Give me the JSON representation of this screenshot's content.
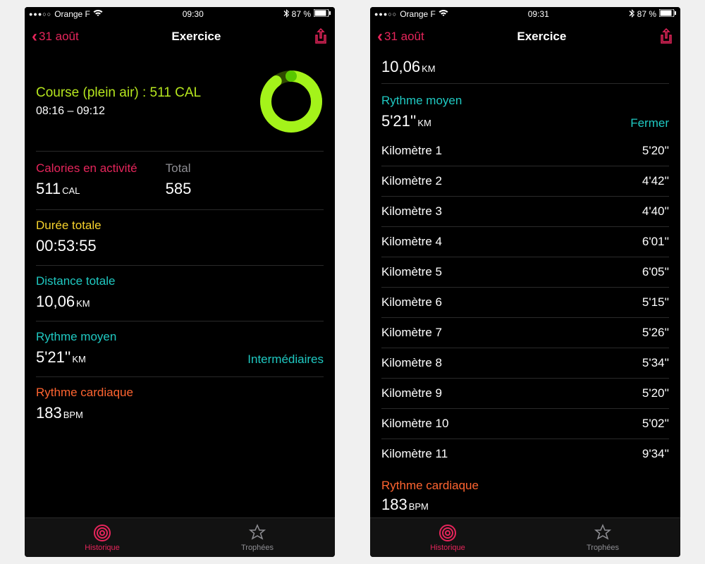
{
  "left": {
    "status": {
      "carrier": "Orange F",
      "time": "09:30",
      "battery": "87 %"
    },
    "nav": {
      "back": "31 août",
      "title": "Exercice"
    },
    "hero": {
      "title": "Course (plein air) : 511 CAL",
      "time": "08:16 – 09:12"
    },
    "active": {
      "label": "Calories en activité",
      "value": "511",
      "unit": "CAL"
    },
    "total": {
      "label": "Total",
      "value": "585"
    },
    "duration": {
      "label": "Durée totale",
      "value": "00:53:55"
    },
    "distance": {
      "label": "Distance totale",
      "value": "10,06",
      "unit": "KM"
    },
    "pace": {
      "label": "Rythme moyen",
      "value": "5'21''",
      "unit": "KM",
      "splits_btn": "Intermédiaires"
    },
    "hr": {
      "label": "Rythme cardiaque",
      "value": "183",
      "unit": "BPM"
    },
    "tabs": {
      "history": "Historique",
      "trophies": "Trophées"
    }
  },
  "right": {
    "status": {
      "carrier": "Orange F",
      "time": "09:31",
      "battery": "87 %"
    },
    "nav": {
      "back": "31 août",
      "title": "Exercice"
    },
    "distance": {
      "value": "10,06",
      "unit": "KM"
    },
    "pace": {
      "label": "Rythme moyen",
      "value": "5'21''",
      "unit": "KM",
      "close_btn": "Fermer"
    },
    "splits": [
      {
        "label": "Kilomètre 1",
        "value": "5'20''"
      },
      {
        "label": "Kilomètre 2",
        "value": "4'42''"
      },
      {
        "label": "Kilomètre 3",
        "value": "4'40''"
      },
      {
        "label": "Kilomètre 4",
        "value": "6'01''"
      },
      {
        "label": "Kilomètre 5",
        "value": "6'05''"
      },
      {
        "label": "Kilomètre 6",
        "value": "5'15''"
      },
      {
        "label": "Kilomètre 7",
        "value": "5'26''"
      },
      {
        "label": "Kilomètre 8",
        "value": "5'34''"
      },
      {
        "label": "Kilomètre 9",
        "value": "5'20''"
      },
      {
        "label": "Kilomètre 10",
        "value": "5'02''"
      },
      {
        "label": "Kilomètre 11",
        "value": "9'34''"
      }
    ],
    "hr": {
      "label": "Rythme cardiaque",
      "value": "183",
      "unit": "BPM"
    },
    "tabs": {
      "history": "Historique",
      "trophies": "Trophées"
    }
  }
}
